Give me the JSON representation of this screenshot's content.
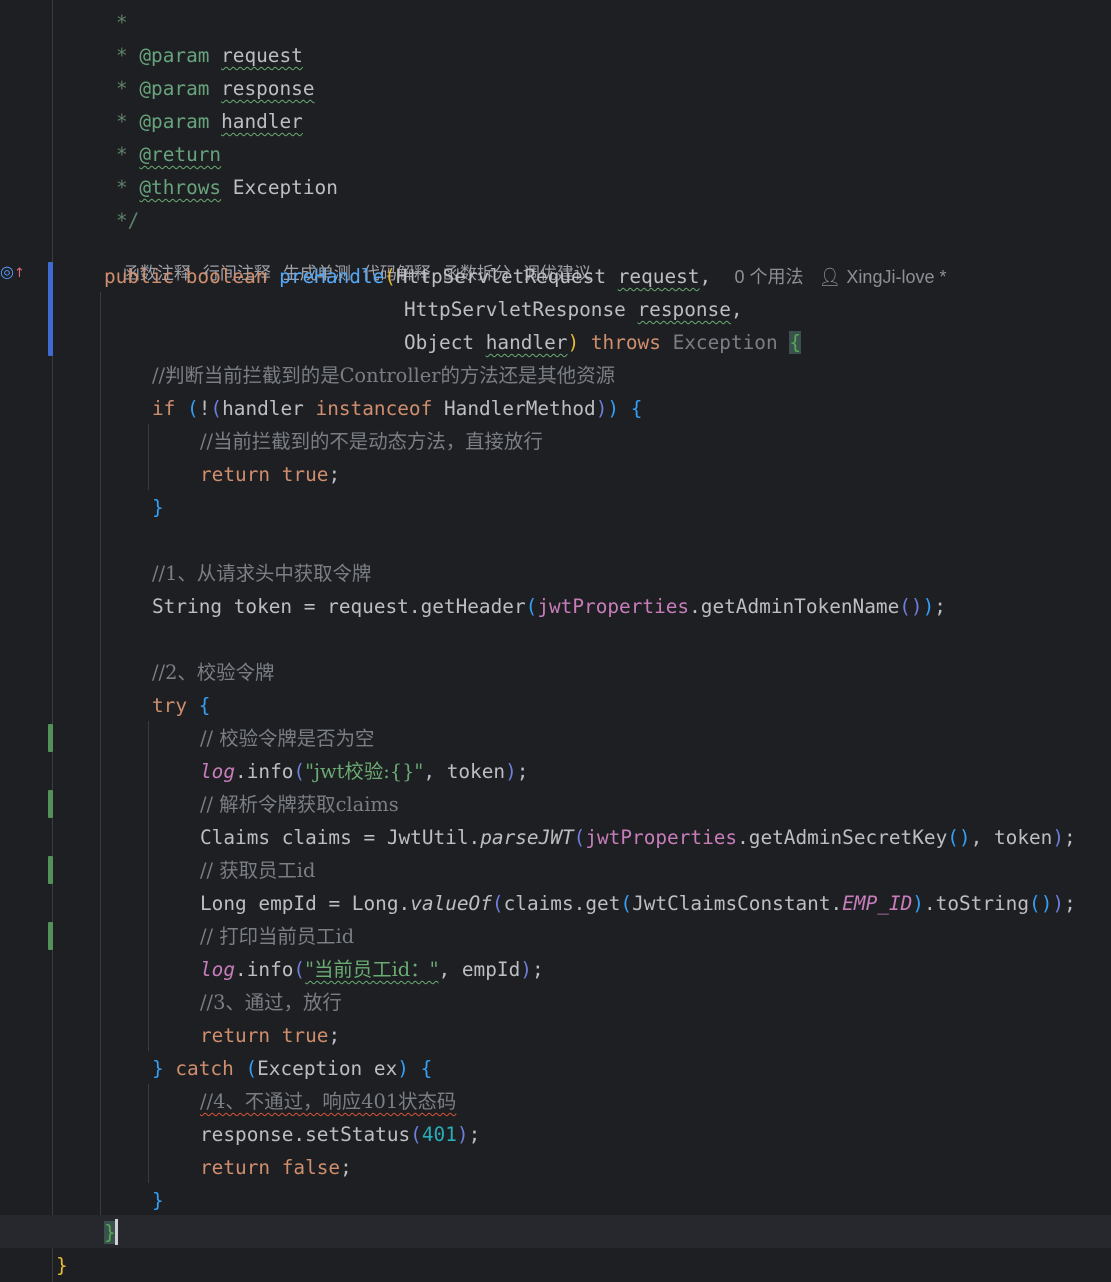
{
  "codeLens": [
    "函数注释",
    "行间注释",
    "生成单测",
    "代码解释",
    "函数拆分",
    "调优建议"
  ],
  "inlayHints": {
    "usages": "0 个用法",
    "author": "XingJi-love *"
  },
  "gutter": {
    "override_icon": "override-up-arrow-icon"
  },
  "code": {
    "doc": {
      "star": "*",
      "param": "@param",
      "return": "@return",
      "throws": "@throws",
      "request": "request",
      "response": "response",
      "handler": "handler",
      "exception": "Exception",
      "end": "*/"
    },
    "sig": {
      "public": "public",
      "boolean": "boolean",
      "name": "preHandle",
      "type1": "HttpServletRequest",
      "arg1": "request",
      "type2": "HttpServletResponse",
      "arg2": "response",
      "type3": "Object",
      "arg3": "handler",
      "throws": "throws",
      "exception": "Exception"
    },
    "c1": "//判断当前拦截到的是Controller的方法还是其他资源",
    "if_kw": "if",
    "not": "!",
    "handler": "handler",
    "instanceof": "instanceof",
    "handlerMethod": "HandlerMethod",
    "c2": "//当前拦截到的不是动态方法，直接放行",
    "return_kw": "return",
    "true_kw": "true",
    "false_kw": "false",
    "c3": "//1、从请求头中获取令牌",
    "string_kw": "String",
    "token": "token",
    "request": "request",
    "getHeader": "getHeader",
    "jwtProperties": "jwtProperties",
    "getAdminTokenName": "getAdminTokenName",
    "c4": "//2、校验令牌",
    "try_kw": "try",
    "c5": "// 校验令牌是否为空",
    "log": "log",
    "info": "info",
    "s1": "\"jwt校验:{}\"",
    "c6": "// 解析令牌获取claims",
    "claimsType": "Claims",
    "claims": "claims",
    "jwtUtil": "JwtUtil",
    "parseJWT": "parseJWT",
    "getAdminSecretKey": "getAdminSecretKey",
    "c7": "// 获取员工id",
    "longType": "Long",
    "empId": "empId",
    "valueOf": "valueOf",
    "get": "get",
    "constClass": "JwtClaimsConstant",
    "empIdConst": "EMP_ID",
    "toString": "toString",
    "c8": "// 打印当前员工id",
    "s2": "\"当前员工id：\"",
    "c9": "//3、通过，放行",
    "catch_kw": "catch",
    "exceptionType": "Exception",
    "ex": "ex",
    "c10": "//4、不通过，响应401状态码",
    "response": "response",
    "setStatus": "setStatus",
    "n401": "401"
  }
}
